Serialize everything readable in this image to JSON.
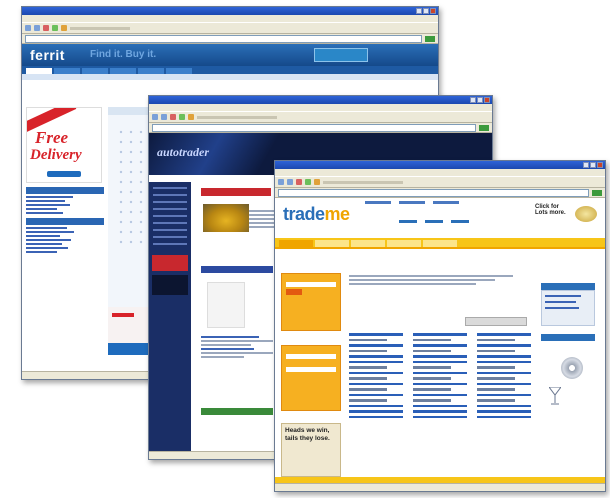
{
  "windows": {
    "ferrit": {
      "logo": "ferrit",
      "tagline": "Find it. Buy it.",
      "promo_line1": "Free",
      "promo_line2": "Delivery"
    },
    "auto": {
      "logo": "autotrader"
    },
    "trademe": {
      "logo_main": "trade",
      "logo_accent": "me",
      "click_for": "Click for Lots more."
    }
  },
  "ad": {
    "text": "Heads we win, tails they lose."
  }
}
